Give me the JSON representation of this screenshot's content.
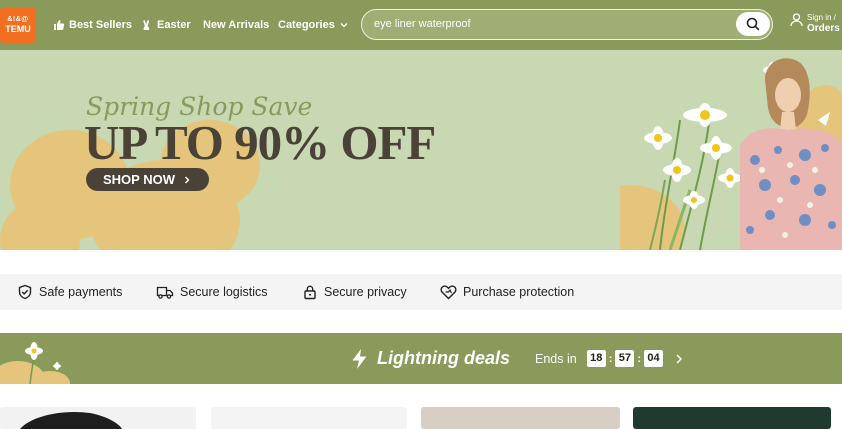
{
  "header": {
    "logo_top": "&!&@",
    "logo_bottom": "TEMU",
    "nav": {
      "best_sellers": "Best Sellers",
      "easter": "Easter",
      "new_arrivals": "New Arrivals",
      "categories": "Categories"
    },
    "search_value": "eye liner waterproof",
    "signin_line1": "Sign in /",
    "signin_line2": "Orders"
  },
  "hero": {
    "script_text": "Spring Shop Save",
    "headline": "UP TO 90% OFF",
    "cta": "SHOP NOW"
  },
  "trust": {
    "safe_payments": "Safe payments",
    "secure_logistics": "Secure logistics",
    "secure_privacy": "Secure privacy",
    "purchase_protection": "Purchase protection"
  },
  "deals": {
    "title": "Lightning deals",
    "ends_in": "Ends in",
    "hours": "18",
    "minutes": "57",
    "seconds": "04"
  },
  "colors": {
    "brand_green": "#8a9a5b",
    "hero_bg": "#c8d8b2",
    "accent_orange": "#f26f21",
    "dark_brown": "#4a4237",
    "blob_yellow": "#e5c57c"
  }
}
